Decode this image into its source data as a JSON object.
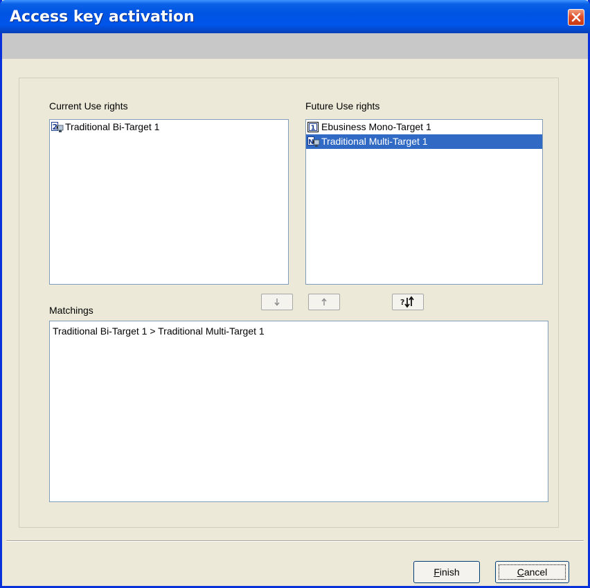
{
  "window": {
    "title": "Access key activation",
    "close_icon": "close-icon"
  },
  "current": {
    "label": "Current Use rights",
    "items": [
      {
        "label": "Traditional Bi-Target 1",
        "icon": "bi-target-icon",
        "selected": false
      }
    ]
  },
  "future": {
    "label": "Future Use rights",
    "items": [
      {
        "label": "Ebusiness Mono-Target 1",
        "icon": "mono-target-icon",
        "selected": false
      },
      {
        "label": "Traditional Multi-Target 1",
        "icon": "multi-target-icon",
        "selected": true
      }
    ]
  },
  "matchings": {
    "label": "Matchings",
    "items": [
      "Traditional Bi-Target 1 > Traditional Multi-Target 1"
    ]
  },
  "toolbar": {
    "move_down_icon": "arrow-down-icon",
    "move_up_icon": "arrow-up-icon",
    "auto_match_icon": "auto-match-icon"
  },
  "footer": {
    "finish": {
      "mnemonic": "F",
      "rest": "inish"
    },
    "cancel": {
      "mnemonic": "C",
      "rest": "ancel"
    }
  },
  "colors": {
    "title_bar": "#0054e3",
    "selection": "#316ac5",
    "dialog_bg": "#ece9d8",
    "close_button": "#e0502c"
  }
}
